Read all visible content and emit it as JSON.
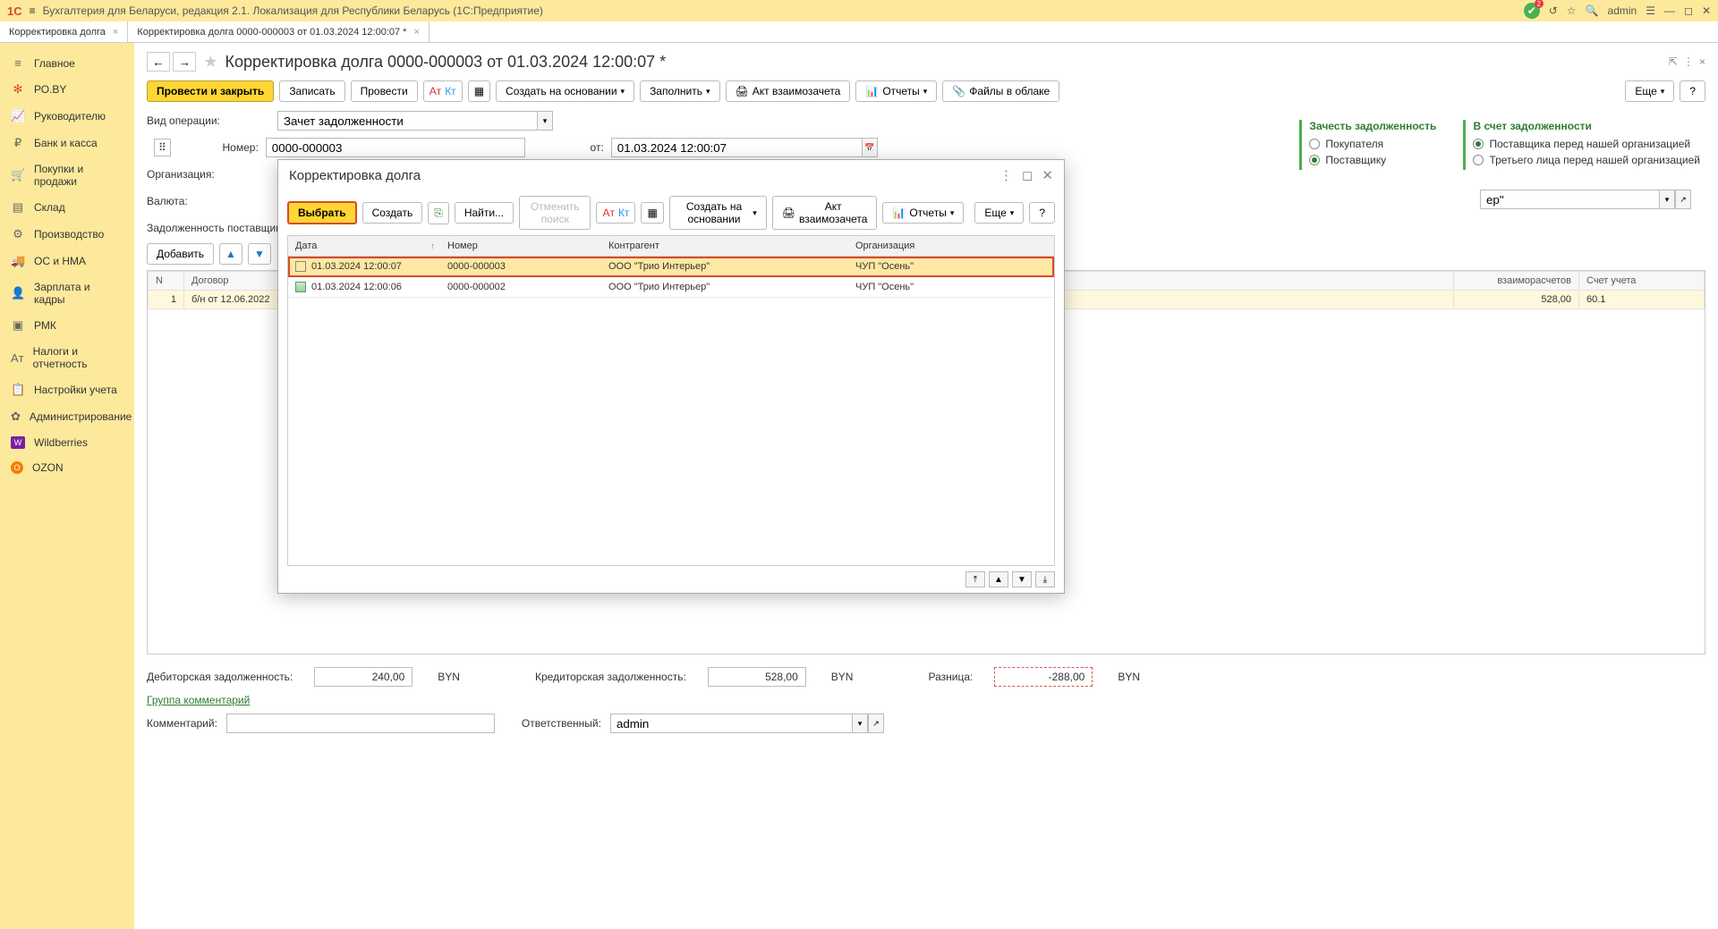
{
  "app": {
    "title": "Бухгалтерия для Беларуси, редакция 2.1. Локализация для Республики Беларусь  (1С:Предприятие)",
    "user": "admin"
  },
  "tabs": [
    {
      "label": "Корректировка долга"
    },
    {
      "label": "Корректировка долга 0000-000003 от 01.03.2024 12:00:07 *"
    }
  ],
  "sidebar": [
    {
      "icon": "≡",
      "label": "Главное"
    },
    {
      "icon": "✻",
      "label": "РО.BY",
      "cls": "red"
    },
    {
      "icon": "📈",
      "label": "Руководителю"
    },
    {
      "icon": "₽",
      "label": "Банк и касса"
    },
    {
      "icon": "🛒",
      "label": "Покупки и продажи"
    },
    {
      "icon": "▤",
      "label": "Склад"
    },
    {
      "icon": "⚙",
      "label": "Производство"
    },
    {
      "icon": "🚚",
      "label": "ОС и НМА"
    },
    {
      "icon": "👤",
      "label": "Зарплата и кадры"
    },
    {
      "icon": "▣",
      "label": "РМК"
    },
    {
      "icon": "Aᴛ",
      "label": "Налоги и отчетность"
    },
    {
      "icon": "📋",
      "label": "Настройки учета"
    },
    {
      "icon": "✿",
      "label": "Администрирование"
    },
    {
      "icon": "W",
      "label": "Wildberries",
      "cls": "purple"
    },
    {
      "icon": "O",
      "label": "OZON",
      "cls": "orange"
    }
  ],
  "page": {
    "title": "Корректировка долга 0000-000003 от 01.03.2024 12:00:07 *"
  },
  "toolbar": {
    "post_close": "Провести и закрыть",
    "write": "Записать",
    "post": "Провести",
    "create_based": "Создать на основании",
    "fill": "Заполнить",
    "offset_act": "Акт взаимозачета",
    "reports": "Отчеты",
    "cloud_files": "Файлы в облаке",
    "more": "Еще",
    "help": "?"
  },
  "form": {
    "op_type_label": "Вид операции:",
    "op_type_value": "Зачет задолженности",
    "number_label": "Номер:",
    "number_value": "0000-000003",
    "from_label": "от:",
    "date_value": "01.03.2024 12:00:07",
    "org_label": "Организация:",
    "org_value": "ЧУП \"Осень\"",
    "currency_label": "Валюта:",
    "currency_value": "BY",
    "tab_label": "Задолженность поставщику (кр",
    "right_partial": "ер\""
  },
  "rightPanel": {
    "left": {
      "title": "Зачесть задолженность",
      "options": [
        {
          "label": "Покупателя",
          "checked": false
        },
        {
          "label": "Поставщику",
          "checked": true
        }
      ]
    },
    "right": {
      "title": "В счет задолженности",
      "options": [
        {
          "label": "Поставщика перед нашей организацией",
          "checked": true
        },
        {
          "label": "Третьего лица перед нашей организацией",
          "checked": false
        }
      ]
    }
  },
  "subToolbar": {
    "add": "Добавить",
    "more": "Еще"
  },
  "mainGrid": {
    "headers": {
      "n": "N",
      "contract": "Договор",
      "settle": "взаиморасчетов",
      "acct": "Счет учета"
    },
    "row": {
      "n": "1",
      "contract": "б/н от 12.06.2022",
      "settle": "528,00",
      "acct": "60.1"
    }
  },
  "footer": {
    "debit_label": "Дебиторская задолженность:",
    "debit_value": "240,00",
    "credit_label": "Кредиторская задолженность:",
    "credit_value": "528,00",
    "diff_label": "Разница:",
    "diff_value": "-288,00",
    "currency": "BYN",
    "group_comment": "Группа комментарий",
    "comment_label": "Комментарий:",
    "resp_label": "Ответственный:",
    "resp_value": "admin"
  },
  "modal": {
    "title": "Корректировка долга",
    "toolbar": {
      "select": "Выбрать",
      "create": "Создать",
      "find": "Найти...",
      "cancel_find": "Отменить поиск",
      "create_based": "Создать на основании",
      "offset_act": "Акт взаимозачета",
      "reports": "Отчеты",
      "more": "Еще",
      "help": "?"
    },
    "headers": {
      "date": "Дата",
      "number": "Номер",
      "contragent": "Контрагент",
      "org": "Организация"
    },
    "rows": [
      {
        "date": "01.03.2024 12:00:07",
        "number": "0000-000003",
        "contragent": "ООО \"Трио Интерьер\"",
        "org": "ЧУП \"Осень\"",
        "posted": false,
        "selected": true
      },
      {
        "date": "01.03.2024 12:00:06",
        "number": "0000-000002",
        "contragent": "ООО \"Трио Интерьер\"",
        "org": "ЧУП \"Осень\"",
        "posted": true,
        "selected": false
      }
    ]
  }
}
